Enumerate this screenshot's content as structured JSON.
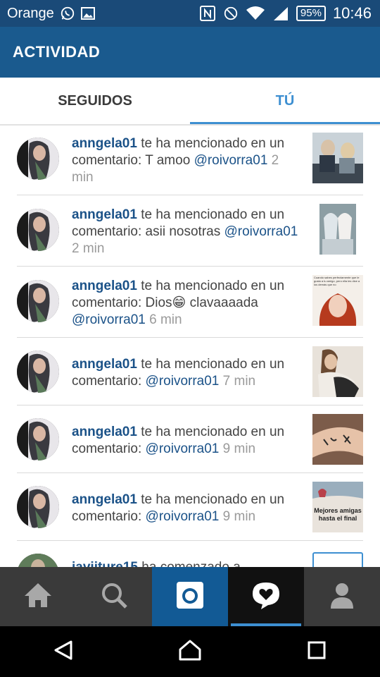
{
  "status_bar": {
    "carrier": "Orange",
    "battery": "95%",
    "time": "10:46"
  },
  "app_bar": {
    "title": "ACTIVIDAD"
  },
  "tabs": [
    {
      "label": "SEGUIDOS",
      "active": false
    },
    {
      "label": "TÚ",
      "active": true
    }
  ],
  "notifications": [
    {
      "user": "anngela01",
      "text": " te ha mencionado en un comentario: T amoo ",
      "mention": "@roivorra01",
      "time": " 2 min"
    },
    {
      "user": "anngela01",
      "text": " te ha mencionado en un comentario: asii nosotras ",
      "mention": "@roivorra01",
      "time": " 2 min"
    },
    {
      "user": "anngela01",
      "text": " te ha mencionado en un comentario: Dios😁 clavaaaada ",
      "mention": "@roivorra01",
      "time": " 6 min"
    },
    {
      "user": "anngela01",
      "text": " te ha mencionado en un comentario: ",
      "mention": "@roivorra01",
      "time": " 7 min"
    },
    {
      "user": "anngela01",
      "text": " te ha mencionado en un comentario: ",
      "mention": "@roivorra01",
      "time": " 9 min"
    },
    {
      "user": "anngela01",
      "text": " te ha mencionado en un comentario: ",
      "mention": "@roivorra01",
      "time": " 9 min"
    },
    {
      "user": "javiiture15",
      "text": " ha comenzado a",
      "mention": "",
      "time": ""
    }
  ],
  "thumbnails": {
    "t3_text": "Cuando sabes perfectamente que le gusta a tu amigo, pero ella les dice a los demás que no",
    "t6_text": "Mejores amigas hasta el final"
  },
  "bottom_nav": [
    "home-icon",
    "search-icon",
    "camera-icon",
    "activity-icon",
    "profile-icon"
  ],
  "colors": {
    "status_bar": "#1a4a78",
    "app_bar": "#1a5a8e",
    "accent": "#3d8fd1",
    "username": "#1b5288",
    "nav_bg": "#3a3a3a",
    "camera_bg": "#125a95"
  }
}
